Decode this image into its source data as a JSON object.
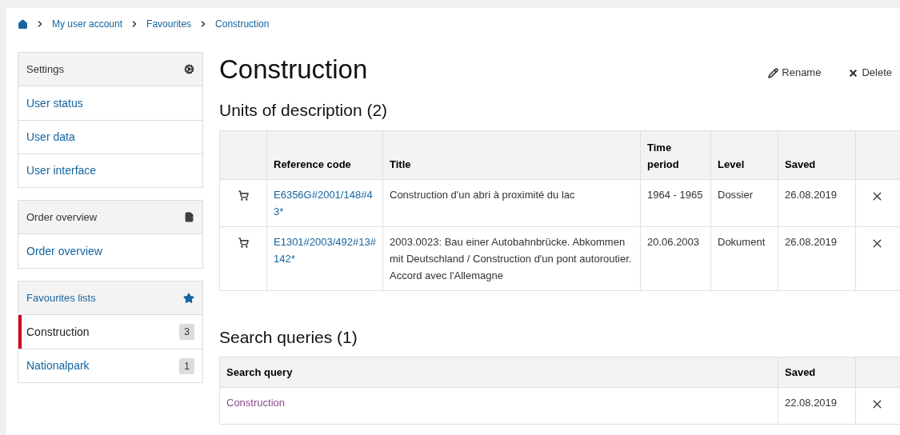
{
  "breadcrumb": [
    "My user account",
    "Favourites",
    "Construction"
  ],
  "sidebar": [
    {
      "title": "Settings",
      "kind": "settings",
      "items": [
        {
          "label": "User status",
          "selected": false
        },
        {
          "label": "User data",
          "selected": false
        },
        {
          "label": "User interface",
          "selected": false
        }
      ]
    },
    {
      "title": "Order overview",
      "kind": "orders",
      "items": [
        {
          "label": "Order overview",
          "selected": false
        }
      ]
    },
    {
      "title": "Favourites lists",
      "kind": "favourites",
      "items": [
        {
          "label": "Construction",
          "selected": true,
          "count": "3"
        },
        {
          "label": "Nationalpark",
          "selected": false,
          "count": "1"
        }
      ]
    }
  ],
  "page_title": "Construction",
  "actions": [
    {
      "kind": "rename",
      "label": "Rename"
    },
    {
      "kind": "delete",
      "label": "Delete"
    }
  ],
  "units": {
    "heading": "Units of description (2)",
    "columns": [
      "Reference code",
      "Title",
      "Time period",
      "Level",
      "Saved"
    ],
    "rows": [
      {
        "reference_code": "E6356G#2001/148#43*",
        "title": "Construction d'un abri à proximité du lac",
        "time_period": "1964 - 1965",
        "level": "Dossier",
        "saved": "26.08.2019"
      },
      {
        "reference_code": "E1301#2003/492#13#142*",
        "title": "2003.0023: Bau einer Autobahnbrücke. Abkommen mit Deutschland / Construction d'un pont autoroutier. Accord avec l'Allemagne",
        "time_period": "20.06.2003",
        "level": "Dokument",
        "saved": "26.08.2019"
      }
    ]
  },
  "queries": {
    "heading": "Search queries (1)",
    "columns": [
      "Search query",
      "Saved"
    ],
    "rows": [
      {
        "query": "Construction",
        "saved": "22.08.2019"
      }
    ]
  }
}
